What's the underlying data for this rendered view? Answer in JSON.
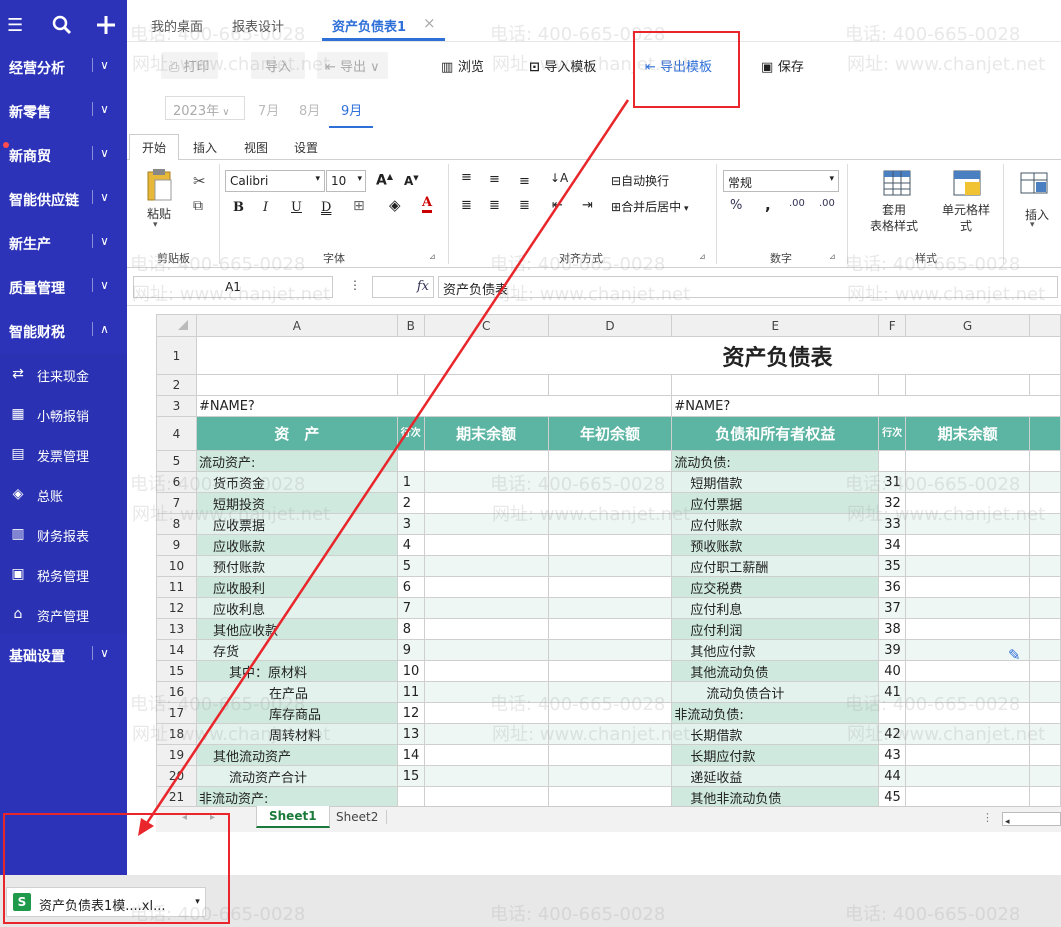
{
  "sidebar": {
    "top_icons": [
      "menu-icon",
      "search-icon",
      "plus-icon"
    ],
    "items": [
      {
        "label": "经营分析",
        "chev": "∨"
      },
      {
        "label": "新零售",
        "chev": "∨"
      },
      {
        "label": "新商贸",
        "chev": "∨"
      },
      {
        "label": "智能供应链",
        "chev": "∨"
      },
      {
        "label": "新生产",
        "chev": "∨"
      },
      {
        "label": "质量管理",
        "chev": "∨"
      },
      {
        "label": "智能财税",
        "chev": "∧"
      }
    ],
    "subitems": [
      {
        "label": "往来现金",
        "icon": "⇄"
      },
      {
        "label": "小畅报销",
        "icon": "▦"
      },
      {
        "label": "发票管理",
        "icon": "▤"
      },
      {
        "label": "总账",
        "icon": "◈"
      },
      {
        "label": "财务报表",
        "icon": "▥"
      },
      {
        "label": "税务管理",
        "icon": "▣"
      },
      {
        "label": "资产管理",
        "icon": "⌂"
      }
    ],
    "footer": {
      "label": "基础设置",
      "chev": "∨"
    }
  },
  "tabs": {
    "items": [
      "我的桌面",
      "报表设计",
      "资产负债表1"
    ],
    "close": "×"
  },
  "toolbar": {
    "print": "打印",
    "import": "导入",
    "export": "导出",
    "browse": "浏览",
    "import_template": "导入模板",
    "export_template": "导出模板",
    "save": "保存"
  },
  "period": {
    "year": "2023年",
    "months": [
      "7月",
      "8月",
      "9月"
    ],
    "active_month": "9月"
  },
  "ribbon": {
    "tabs": [
      "开始",
      "插入",
      "视图",
      "设置"
    ],
    "paste": "粘贴",
    "font_name": "Calibri",
    "font_size": "10",
    "wrap": "自动换行",
    "merge": "合并后居中",
    "number_format": "常规",
    "table_style": "套用\n表格样式",
    "cell_style": "单元格样\n式",
    "insert": "插入",
    "groups": {
      "clipboard": "剪贴板",
      "font": "字体",
      "align": "对齐方式",
      "number": "数字",
      "style": "样式"
    }
  },
  "formula_bar": {
    "cell_ref": "A1",
    "fx": "fx",
    "content": "资产负债表"
  },
  "sheet": {
    "col_headers": [
      "A",
      "B",
      "C",
      "D",
      "E",
      "F",
      "G"
    ],
    "title": "资产负债表",
    "name_err": "#NAME?",
    "header": {
      "asset": "资　产",
      "rownum": "行次",
      "end_balance": "期末余额",
      "begin_balance": "年初余额",
      "liability": "负债和所有者权益",
      "rownum2": "行次",
      "end_balance2": "期末余额"
    },
    "rows": [
      {
        "n": "5",
        "a": "流动资产:",
        "b": "",
        "e": "流动负债:",
        "f": ""
      },
      {
        "n": "6",
        "a": "货币资金",
        "b": "1",
        "e": "短期借款",
        "f": "31"
      },
      {
        "n": "7",
        "a": "短期投资",
        "b": "2",
        "e": "应付票据",
        "f": "32"
      },
      {
        "n": "8",
        "a": "应收票据",
        "b": "3",
        "e": "应付账款",
        "f": "33"
      },
      {
        "n": "9",
        "a": "应收账款",
        "b": "4",
        "e": "预收账款",
        "f": "34"
      },
      {
        "n": "10",
        "a": "预付账款",
        "b": "5",
        "e": "应付职工薪酬",
        "f": "35"
      },
      {
        "n": "11",
        "a": "应收股利",
        "b": "6",
        "e": "应交税费",
        "f": "36"
      },
      {
        "n": "12",
        "a": "应收利息",
        "b": "7",
        "e": "应付利息",
        "f": "37"
      },
      {
        "n": "13",
        "a": "其他应收款",
        "b": "8",
        "e": "应付利润",
        "f": "38"
      },
      {
        "n": "14",
        "a": "存货",
        "b": "9",
        "e": "其他应付款",
        "f": "39"
      },
      {
        "n": "15",
        "a": "其中：原材料",
        "b": "10",
        "e": "其他流动负债",
        "f": "40"
      },
      {
        "n": "16",
        "a": "在产品",
        "b": "11",
        "e": "流动负债合计",
        "f": "41"
      },
      {
        "n": "17",
        "a": "库存商品",
        "b": "12",
        "e": "非流动负债:",
        "f": ""
      },
      {
        "n": "18",
        "a": "周转材料",
        "b": "13",
        "e": "长期借款",
        "f": "42"
      },
      {
        "n": "19",
        "a": "其他流动资产",
        "b": "14",
        "e": "长期应付款",
        "f": "43"
      },
      {
        "n": "20",
        "a": "流动资产合计",
        "b": "15",
        "e": "递延收益",
        "f": "44"
      },
      {
        "n": "21",
        "a": "非流动资产:",
        "b": "",
        "e": "其他非流动负债",
        "f": "45"
      }
    ],
    "sheet_tabs": [
      "Sheet1",
      "Sheet2"
    ]
  },
  "download": {
    "file_label": "资产负债表1模....xl...",
    "icon_letter": "S"
  },
  "watermark": {
    "phone": "电话: 400-665-0028",
    "site": "网址: www.chanjet.net"
  },
  "colors": {
    "sidebar": "#2c33b8",
    "accent": "#2e6fd8",
    "teal": "#5bb5a2",
    "red": "#e8262b"
  }
}
